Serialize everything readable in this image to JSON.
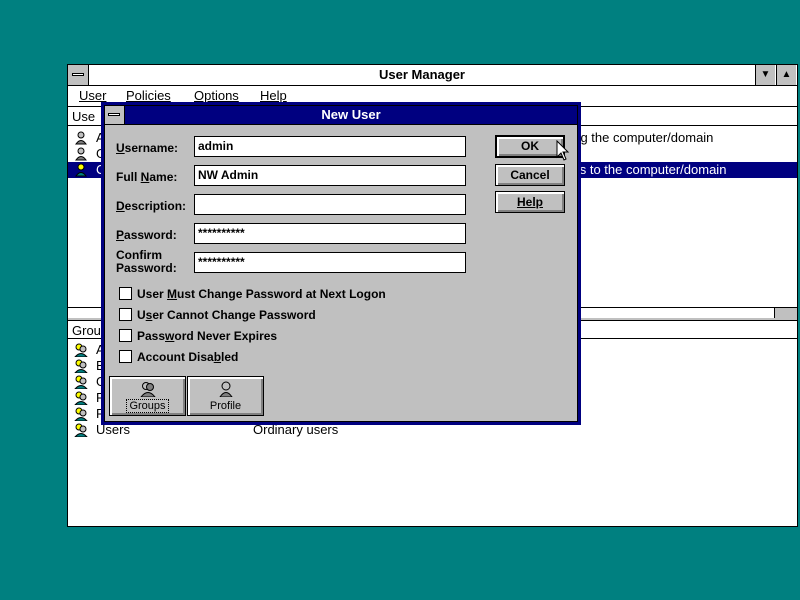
{
  "main_window": {
    "title": "User Manager",
    "minimize_glyph": "▼",
    "maximize_glyph": "▲",
    "menu": [
      {
        "label": "User"
      },
      {
        "label": "Policies"
      },
      {
        "label": "Options"
      },
      {
        "label": "Help"
      }
    ],
    "user_column_header": "Use",
    "users": [
      {
        "name": "A",
        "description": "ring the computer/domain",
        "selected": false
      },
      {
        "name": "G",
        "description": "",
        "selected": false
      },
      {
        "name": "C",
        "description": "ess to the computer/domain",
        "selected": true
      }
    ],
    "group_column_header": "Grou",
    "groups": [
      {
        "name": "A",
        "description": ""
      },
      {
        "name": "B",
        "description": ""
      },
      {
        "name": "G",
        "description": ""
      },
      {
        "name": "P",
        "description": ""
      },
      {
        "name": "R",
        "description": ""
      },
      {
        "name": "Users",
        "description": "Ordinary users"
      }
    ]
  },
  "dialog": {
    "title": "New User",
    "fields": {
      "username": {
        "label_pre": "",
        "label_ul": "U",
        "label_post": "sername:",
        "value": "admin"
      },
      "full_name": {
        "label_pre": "Full ",
        "label_ul": "N",
        "label_post": "ame:",
        "value": "NW Admin"
      },
      "description": {
        "label_pre": "",
        "label_ul": "D",
        "label_post": "escription:",
        "value": ""
      },
      "password": {
        "label_pre": "",
        "label_ul": "P",
        "label_post": "assword:",
        "value": "**********"
      },
      "confirm_password": {
        "label_line1": "Confirm",
        "label_line2": "Password:",
        "value": "**********"
      }
    },
    "checkboxes": [
      {
        "pre": "User ",
        "ul": "M",
        "post": "ust Change Password at Next Logon",
        "checked": false
      },
      {
        "pre": "U",
        "ul": "s",
        "post": "er Cannot Change Password",
        "checked": false
      },
      {
        "pre": "Pass",
        "ul": "w",
        "post": "ord Never Expires",
        "checked": false
      },
      {
        "pre": "Account Disa",
        "ul": "b",
        "post": "led",
        "checked": false
      }
    ],
    "buttons": {
      "ok": "OK",
      "cancel": "Cancel",
      "help": "Help"
    },
    "icon_buttons": {
      "groups": {
        "label": "Groups",
        "icon": "groups-icon"
      },
      "profile": {
        "label": "Profile",
        "icon": "profile-icon"
      }
    }
  },
  "colors": {
    "desktop": "#008080",
    "titlebar_active": "#000080",
    "face": "#c0c0c0",
    "selection": "#000080"
  }
}
